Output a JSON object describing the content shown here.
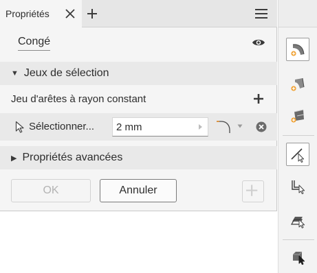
{
  "tab": {
    "label": "Propriétés"
  },
  "panel": {
    "title": "Congé"
  },
  "sections": {
    "selection_sets": {
      "label": "Jeux de sélection",
      "expanded": true
    },
    "advanced": {
      "label": "Propriétés avancées",
      "expanded": false
    }
  },
  "chain": {
    "label": "Jeu d'arêtes à rayon constant"
  },
  "selection": {
    "label": "Sélectionner...",
    "radius": "2 mm"
  },
  "buttons": {
    "ok": "OK",
    "cancel": "Annuler"
  },
  "icons": {
    "tab_close": "close-icon",
    "tab_add": "plus-icon",
    "menu": "hamburger-menu-icon",
    "visibility": "eye-icon",
    "add_set": "plus-icon",
    "select": "cursor-arrow-icon",
    "profile": "fillet-profile-icon",
    "remove": "remove-circle-icon",
    "apply": "plus-icon"
  },
  "toolbar": [
    {
      "icon": "fillet-edge-icon",
      "active": true
    },
    {
      "icon": "fillet-face-icon",
      "active": false
    },
    {
      "icon": "fillet-full-round-icon",
      "active": false
    },
    {
      "icon": "select-edge-icon",
      "active": true
    },
    {
      "icon": "select-loop-icon",
      "active": false
    },
    {
      "icon": "select-feature-icon",
      "active": false
    },
    {
      "icon": "select-solid-icon",
      "active": false
    }
  ],
  "colors": {
    "panel_bg": "#f5f5f5",
    "section_bg": "#e9e9e9",
    "accent_orange": "#f0a030",
    "text": "#2d2d2d",
    "disabled_text": "#b3b3b3"
  }
}
